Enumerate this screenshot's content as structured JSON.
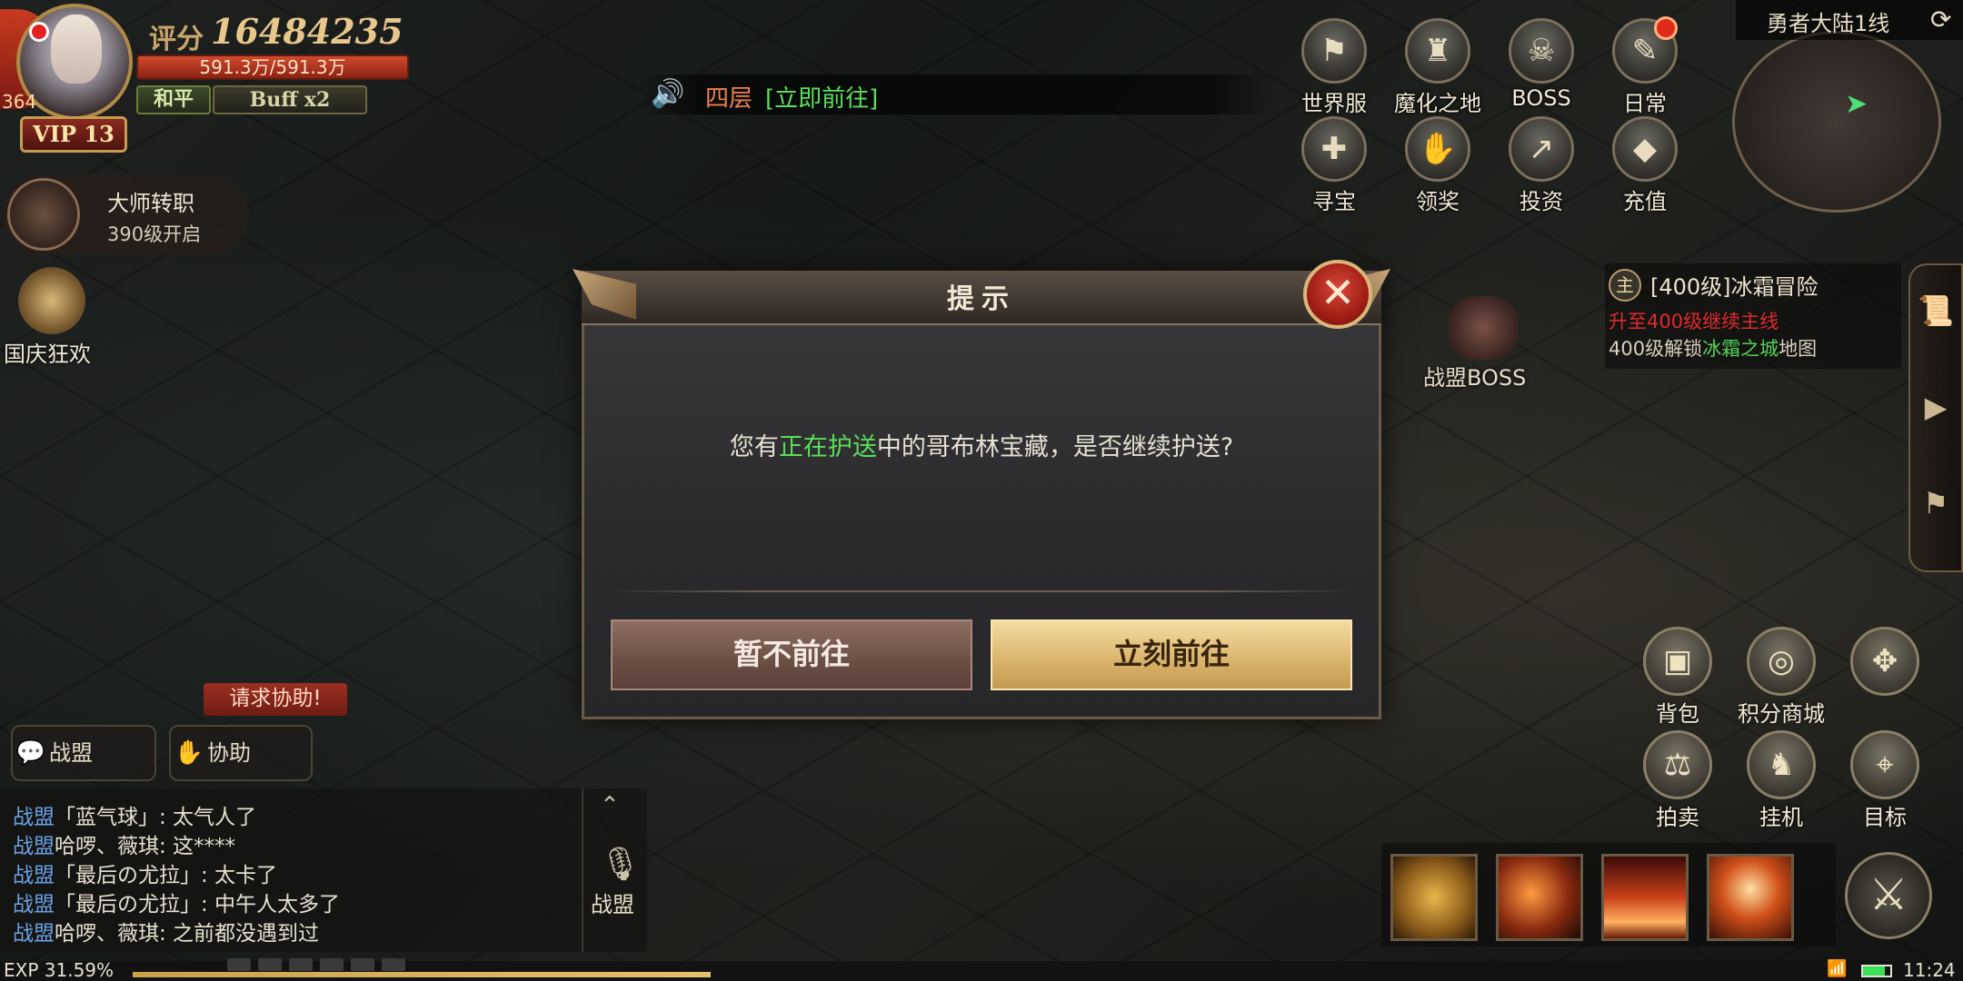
{
  "player": {
    "level": "364",
    "vip": "VIP 13",
    "score_label": "评分",
    "score": "16484235",
    "hp": "591.3万/591.3万",
    "mode": "和平",
    "buff": "Buff x2"
  },
  "left_panel": {
    "master_title": "大师转职",
    "master_sub": "390级开启",
    "event_label": "国庆狂欢"
  },
  "announcement": {
    "text": "四层",
    "link": "[立即前往]"
  },
  "top_menu": [
    {
      "label": "世界服",
      "icon": "world-server-icon",
      "glyph": "⚑"
    },
    {
      "label": "魔化之地",
      "icon": "demon-land-icon",
      "glyph": "♜"
    },
    {
      "label": "BOSS",
      "icon": "boss-skull-icon",
      "glyph": "☠"
    },
    {
      "label": "日常",
      "icon": "daily-scroll-icon",
      "glyph": "✎"
    },
    {
      "label": "寻宝",
      "icon": "treasure-gift-icon",
      "glyph": "✚"
    },
    {
      "label": "领奖",
      "icon": "reward-hand-icon",
      "glyph": "✋"
    },
    {
      "label": "投资",
      "icon": "invest-coins-icon",
      "glyph": "↗"
    },
    {
      "label": "充值",
      "icon": "recharge-diamond-icon",
      "glyph": "◆"
    }
  ],
  "minimap": {
    "server": "勇者大陆1线"
  },
  "quest": {
    "tag": "主",
    "title": "[400级]冰霜冒险",
    "hint": "升至400级继续主线",
    "unlock_pre": "400级解锁",
    "unlock_place": "冰霜之城",
    "unlock_post": "地图"
  },
  "guild_boss_label": "战盟BOSS",
  "dialog": {
    "title": "提示",
    "msg_pre": "您有",
    "msg_highlight": "正在护送",
    "msg_post": "中的哥布林宝藏，是否继续护送?",
    "cancel": "暂不前往",
    "confirm": "立刻前往"
  },
  "chat": {
    "help_tag": "请求协助!",
    "btn_guild": "战盟",
    "btn_assist": "协助",
    "side_label": "战盟",
    "lines": [
      {
        "channel": "战盟",
        "text": "「蓝气球」: 太气人了"
      },
      {
        "channel": "战盟",
        "text": "哈啰、薇琪: 这****"
      },
      {
        "channel": "战盟",
        "text": "「最后の尤拉」: 太卡了"
      },
      {
        "channel": "战盟",
        "text": "「最后の尤拉」: 中午人太多了"
      },
      {
        "channel": "战盟",
        "text": "哈啰、薇琪: 之前都没遇到过"
      }
    ]
  },
  "functions": [
    {
      "label": "背包",
      "glyph": "▣",
      "icon": "backpack-icon"
    },
    {
      "label": "积分商城",
      "glyph": "◎",
      "icon": "points-shop-icon"
    },
    {
      "label": "",
      "glyph": "✥",
      "icon": "compass-icon"
    },
    {
      "label": "拍卖",
      "glyph": "⚖",
      "icon": "auction-scale-icon"
    },
    {
      "label": "挂机",
      "glyph": "♞",
      "icon": "auto-battle-icon"
    },
    {
      "label": "目标",
      "glyph": "⌖",
      "icon": "target-icon"
    }
  ],
  "status": {
    "exp": "EXP 31.59%",
    "exp_fraction": 0.3159,
    "time": "11:24"
  },
  "colors": {
    "accent_gold": "#d9b36a",
    "highlight_green": "#5ade5a",
    "alert_red": "#e02a2a"
  }
}
